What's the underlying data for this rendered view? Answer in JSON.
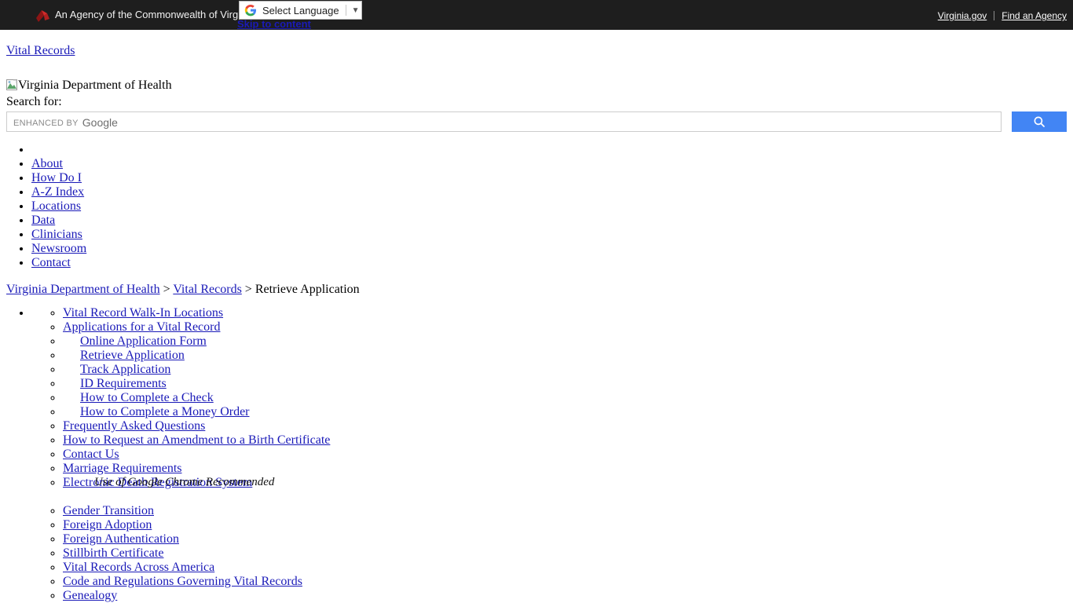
{
  "agency_bar": {
    "logo_icon": "virginia-gov-logo-icon",
    "text": "An Agency of the Commonwealth of Virginia",
    "links": [
      {
        "label": "Virginia.gov"
      },
      {
        "label": "Find an Agency"
      }
    ]
  },
  "skip_link": {
    "label": "Skip to content"
  },
  "translate_widget": {
    "icon": "google-g-icon",
    "label": "Select Language",
    "caret_icon": "chevron-down-icon"
  },
  "header": {
    "vital_records_link": "Vital Records",
    "logo_alt": "Virginia Department of Health",
    "broken_image_icon": "broken-image-icon"
  },
  "search": {
    "label": "Search for:",
    "placeholder": "",
    "value": "",
    "watermark_prefix": "ENHANCED BY",
    "watermark_brand": "Google",
    "button_icon": "search-icon",
    "button_color": "#4285f4"
  },
  "main_nav": {
    "items": [
      {
        "label": ""
      },
      {
        "label": "About"
      },
      {
        "label": "How Do I"
      },
      {
        "label": "A-Z Index"
      },
      {
        "label": "Locations"
      },
      {
        "label": "Data"
      },
      {
        "label": "Clinicians"
      },
      {
        "label": "Newsroom"
      },
      {
        "label": "Contact"
      }
    ]
  },
  "breadcrumb": {
    "home": "Virginia Department of Health",
    "sep1": ">",
    "section": "Vital Records",
    "sep2": ">",
    "current": "Retrieve Application"
  },
  "side_nav": {
    "items": [
      {
        "label": "Vital Record Walk-In Locations",
        "indented": false
      },
      {
        "label": "Applications for a Vital Record",
        "indented": false
      },
      {
        "label": "Online Application Form",
        "indented": true
      },
      {
        "label": "Retrieve Application",
        "indented": true
      },
      {
        "label": "Track Application",
        "indented": true
      },
      {
        "label": "ID Requirements",
        "indented": true
      },
      {
        "label": "How to Complete a Check",
        "indented": true
      },
      {
        "label": "How to Complete a Money Order",
        "indented": true
      },
      {
        "label": "Frequently Asked Questions",
        "indented": false
      },
      {
        "label": "How to Request an Amendment to a Birth Certificate",
        "indented": false
      },
      {
        "label": "Contact Us",
        "indented": false
      },
      {
        "label": "Marriage Requirements",
        "indented": false
      },
      {
        "label": "Electronic Death Registration System",
        "indented": false
      },
      {
        "label": "Gender Transition",
        "indented": false
      },
      {
        "label": "Foreign Adoption",
        "indented": false
      },
      {
        "label": "Foreign Authentication",
        "indented": false
      },
      {
        "label": "Stillbirth Certificate",
        "indented": false
      },
      {
        "label": "Vital Records Across America",
        "indented": false
      },
      {
        "label": "Code and Regulations Governing Vital Records",
        "indented": false
      },
      {
        "label": "Genealogy",
        "indented": false
      }
    ]
  },
  "chrome_note": {
    "text": "Use of Google Chrome Recommended"
  }
}
